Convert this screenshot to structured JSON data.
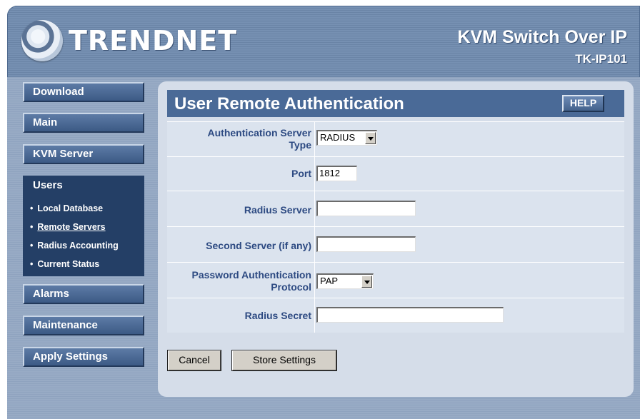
{
  "header": {
    "logo_text": "TRENDNET",
    "product_name": "KVM Switch Over IP",
    "model": "TK-IP101"
  },
  "sidebar": {
    "buttons": [
      {
        "label": "Download"
      },
      {
        "label": "Main"
      },
      {
        "label": "KVM Server"
      },
      {
        "label": "Users"
      },
      {
        "label": "Alarms"
      },
      {
        "label": "Maintenance"
      },
      {
        "label": "Apply Settings"
      }
    ],
    "active": "Users",
    "submenu": [
      {
        "label": "Local Database"
      },
      {
        "label": "Remote Servers"
      },
      {
        "label": "Radius Accounting"
      },
      {
        "label": "Current Status"
      }
    ],
    "submenu_current": "Remote Servers"
  },
  "panel": {
    "title": "User Remote Authentication",
    "help_label": "HELP",
    "fields": {
      "auth_type": {
        "label_line1": "Authentication Server",
        "label_line2": "Type",
        "value": "RADIUS"
      },
      "port": {
        "label": "Port",
        "value": "1812"
      },
      "radius_server": {
        "label": "Radius Server",
        "value": ""
      },
      "second_server": {
        "label": "Second Server (if any)",
        "value": ""
      },
      "password_protocol": {
        "label_line1": "Password Authentication",
        "label_line2": "Protocol",
        "value": "PAP"
      },
      "radius_secret": {
        "label": "Radius Secret",
        "value": ""
      }
    },
    "cancel_label": "Cancel",
    "store_label": "Store Settings"
  }
}
